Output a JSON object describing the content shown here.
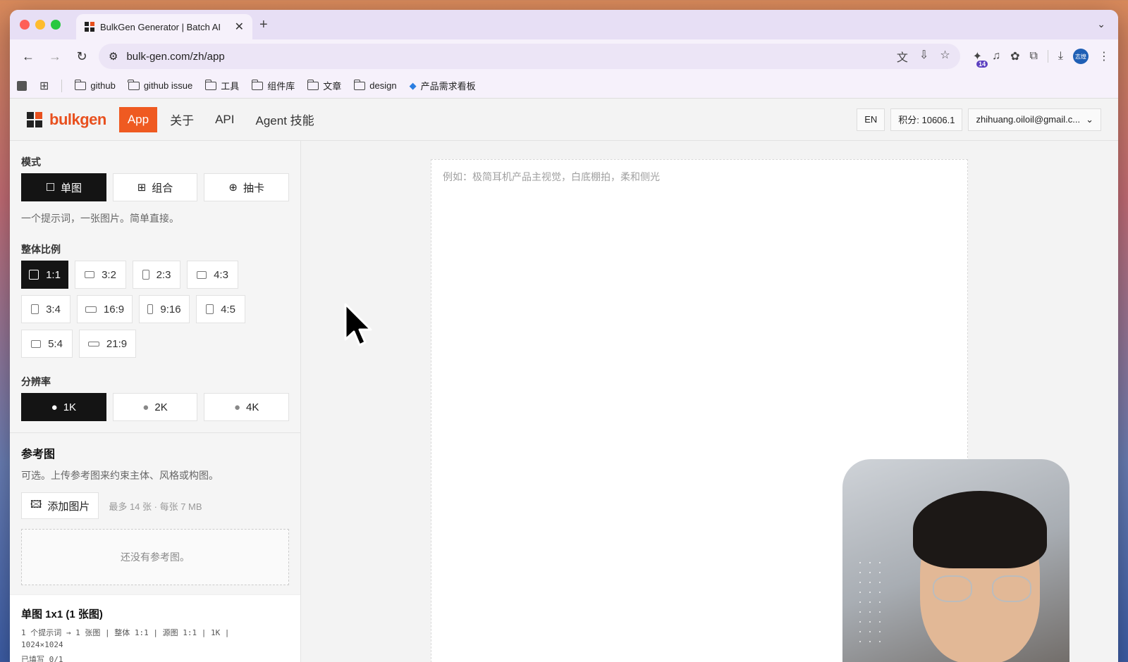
{
  "browser": {
    "tab_title": "BulkGen Generator | Batch AI",
    "url": "bulk-gen.com/zh/app",
    "profile_label": "志煌",
    "ext_badge": "14",
    "bookmarks": [
      "github",
      "github issue",
      "工具",
      "组件库",
      "文章",
      "design",
      "产品需求看板"
    ]
  },
  "header": {
    "brand": "bulkgen",
    "nav": [
      "App",
      "关于",
      "API",
      "Agent 技能"
    ],
    "lang": "EN",
    "credits": "积分: 10606.1",
    "account": "zhihuang.oiloil@gmail.c..."
  },
  "mode": {
    "label": "模式",
    "options": [
      "单图",
      "组合",
      "抽卡"
    ],
    "selected": "单图",
    "hint": "一个提示词，一张图片。简单直接。"
  },
  "ratio": {
    "label": "整体比例",
    "options": [
      "1:1",
      "3:2",
      "2:3",
      "4:3",
      "3:4",
      "16:9",
      "9:16",
      "4:5",
      "5:4",
      "21:9"
    ],
    "selected": "1:1"
  },
  "resolution": {
    "label": "分辨率",
    "options": [
      "1K",
      "2K",
      "4K"
    ],
    "selected": "1K"
  },
  "reference": {
    "title": "参考图",
    "desc": "可选。上传参考图来约束主体、风格或构图。",
    "add_label": "添加图片",
    "limit": "最多 14 张 · 每张 7 MB",
    "empty": "还没有参考图。"
  },
  "summary": {
    "title": "单图 1x1 (1 张图)",
    "line1": "1 个提示词 → 1 张图 | 整体 1:1 | 源图 1:1 | 1K |",
    "line2": "1024×1024",
    "line3": "已填写 0/1"
  },
  "prompt": {
    "placeholder": "例如：极简耳机产品主视觉，白底棚拍，柔和侧光"
  },
  "colors": {
    "accent": "#ef5a21",
    "selected": "#141414"
  }
}
